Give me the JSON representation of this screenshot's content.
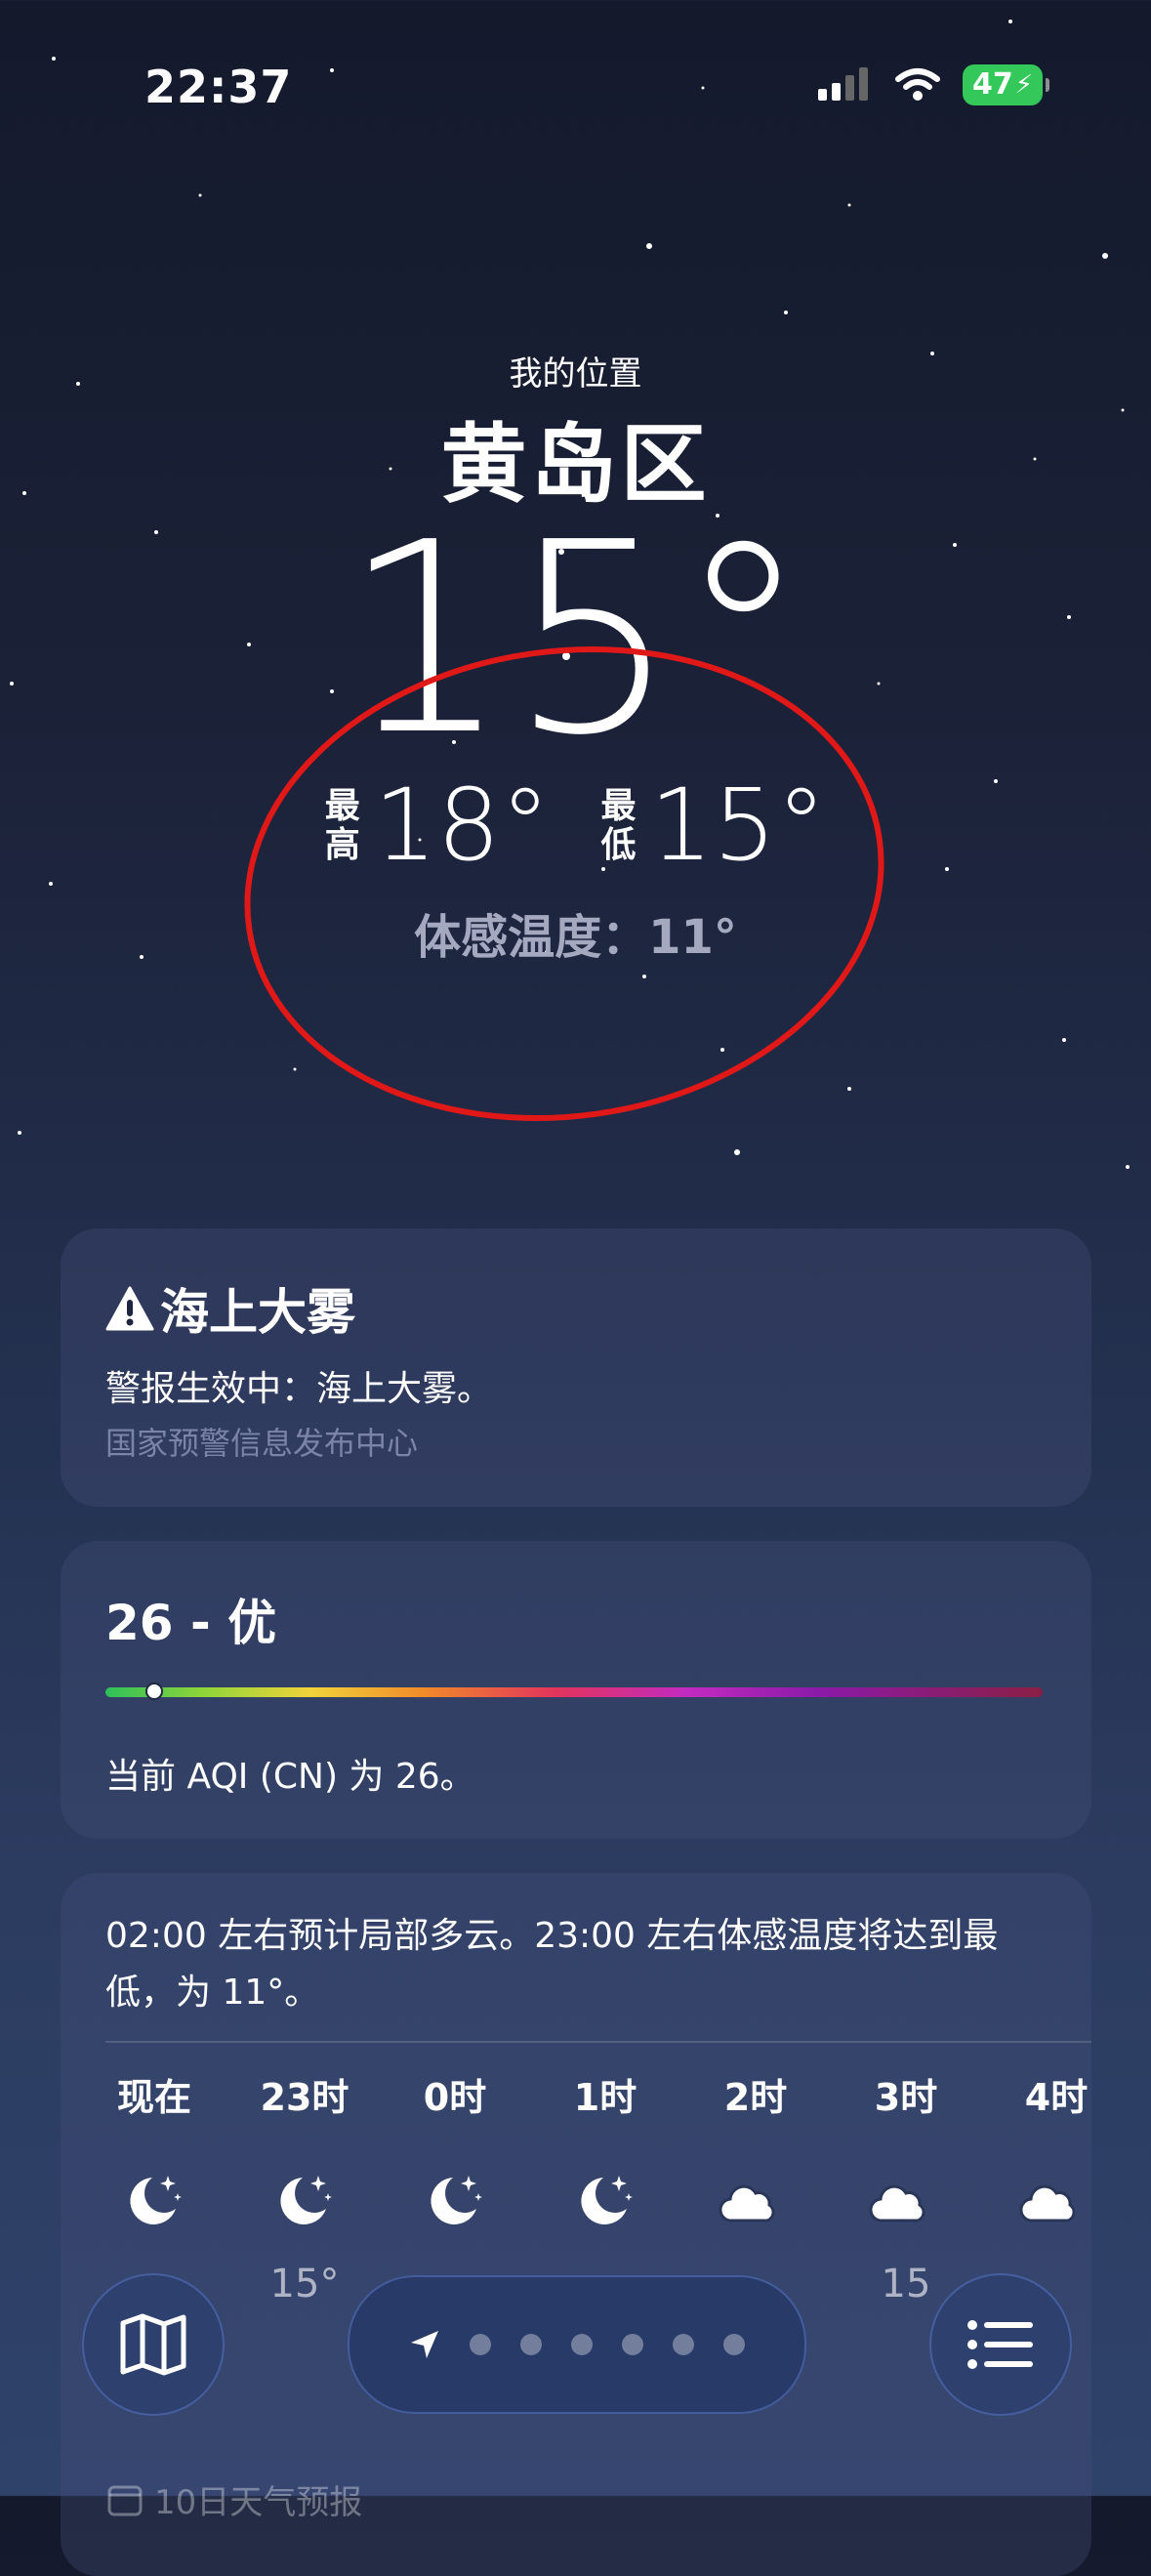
{
  "status_bar": {
    "time": "22:37",
    "battery": "47"
  },
  "location": {
    "subtitle": "我的位置",
    "name": "黄岛区"
  },
  "current": {
    "temperature": "15°",
    "high_label_1": "最",
    "high_label_2": "高",
    "high": "18°",
    "low_label_1": "最",
    "low_label_2": "低",
    "low": "15°",
    "feels_like": "体感温度：11°"
  },
  "alert": {
    "icon": "warning-triangle-icon",
    "title": "海上大雾",
    "body": "警报生效中：海上大雾。",
    "source": "国家预警信息发布中心"
  },
  "aqi": {
    "title": "26 - 优",
    "value": 26,
    "description": "当前 AQI (CN) 为 26。"
  },
  "hourly": {
    "summary": "02:00 左右预计局部多云。23:00 左右体感温度将达到最低，为 11°。",
    "hours": [
      {
        "label": "现在",
        "icon": "moon-stars-icon",
        "temp": ""
      },
      {
        "label": "23时",
        "icon": "moon-stars-icon",
        "temp": "15°"
      },
      {
        "label": "0时",
        "icon": "moon-stars-icon",
        "temp": ""
      },
      {
        "label": "1时",
        "icon": "moon-stars-icon",
        "temp": ""
      },
      {
        "label": "2时",
        "icon": "cloud-moon-icon",
        "temp": ""
      },
      {
        "label": "3时",
        "icon": "cloud-moon-icon",
        "temp": "15"
      },
      {
        "label": "4时",
        "icon": "cloud-moon-icon",
        "temp": ""
      }
    ]
  },
  "forecast_10day": {
    "label": "10日天气预报"
  },
  "toolbar": {
    "pages": 6
  }
}
